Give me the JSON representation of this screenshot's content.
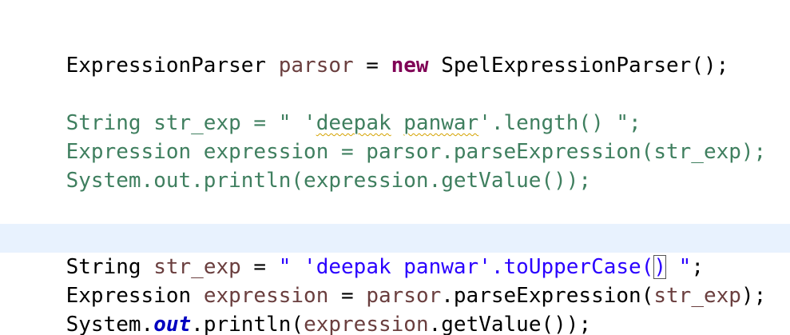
{
  "colors": {
    "background": "#ffffff",
    "current_line": "#e8f2fe",
    "comment": "#3f7f5f",
    "keyword": "#7f0055",
    "string": "#2a00ff",
    "local_variable": "#6a3e3e",
    "static_field": "#0000c0",
    "plain": "#000000"
  },
  "editor": {
    "line1": {
      "t1": "ExpressionParser ",
      "t2": "parsor",
      "t3": " = ",
      "t4": "new",
      "t5": " SpelExpressionParser();"
    },
    "line2": {
      "t1": "String str_exp = \" '",
      "t2": "deepak",
      "t3": " ",
      "t4": "panwar",
      "t5": "'.length() \";"
    },
    "line3": {
      "t1": "Expression expression = parsor.parseExpression(str_exp);"
    },
    "line4": {
      "t1": "System.out.println(expression.getValue());"
    },
    "line5": {
      "t1": "String ",
      "t2": "str_exp",
      "t3": " = ",
      "t4": "\" 'deepak panwar'.toUpperCase(",
      "t5": ")",
      "t6": " \"",
      "t7": ";"
    },
    "line6": {
      "t1": "Expression ",
      "t2": "expression",
      "t3": " = ",
      "t4": "parsor",
      "t5": ".parseExpression(",
      "t6": "str_exp",
      "t7": ");"
    },
    "line7": {
      "t1": "System.",
      "t2": "out",
      "t3": ".println(",
      "t4": "expression",
      "t5": ".getValue());"
    }
  }
}
